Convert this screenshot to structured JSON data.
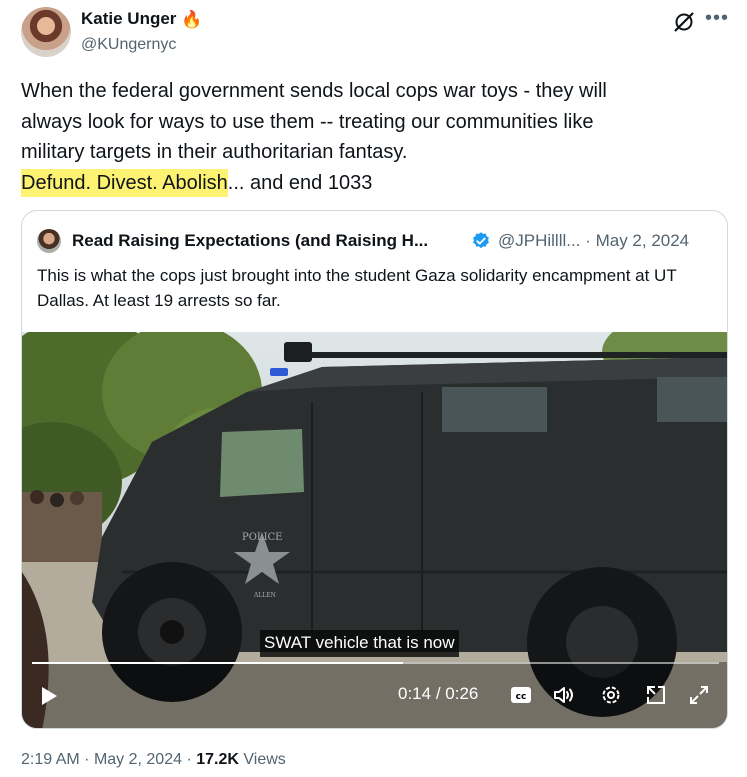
{
  "author": {
    "name": "Katie Unger",
    "emoji": "🔥",
    "handle": "@KUngernyc"
  },
  "tweet": {
    "line1": "When the federal government sends local cops war toys - they will",
    "line2": "always look for ways to use them -- treating our communities like",
    "line3": "military targets in their authoritarian fantasy.",
    "highlighted": "Defund. Divest. Abolish",
    "rest": "... and end 1033"
  },
  "quoted": {
    "name": "Read Raising Expectations (and Raising H...",
    "handle": "@JPHillll...",
    "separator": "·",
    "date": "May 2, 2024",
    "text": "This is what the cops just brought into the student Gaza solidarity encampment at UT Dallas. At least 19 arrests so far."
  },
  "video": {
    "caption": "SWAT vehicle that is now",
    "current_time": "0:14",
    "time_sep": "/",
    "duration": "0:26",
    "progress_fraction": 0.54,
    "cc_label": "cc",
    "door_text": "POLICE",
    "door_subtext": "ALLEN"
  },
  "footer": {
    "time": "2:19 AM",
    "dot": "·",
    "date": "May 2, 2024",
    "views_count": "17.2K",
    "views_label": "Views"
  },
  "colors": {
    "highlight": "#fdf272",
    "verified": "#1d9bf0",
    "secondary_text": "#536471"
  }
}
